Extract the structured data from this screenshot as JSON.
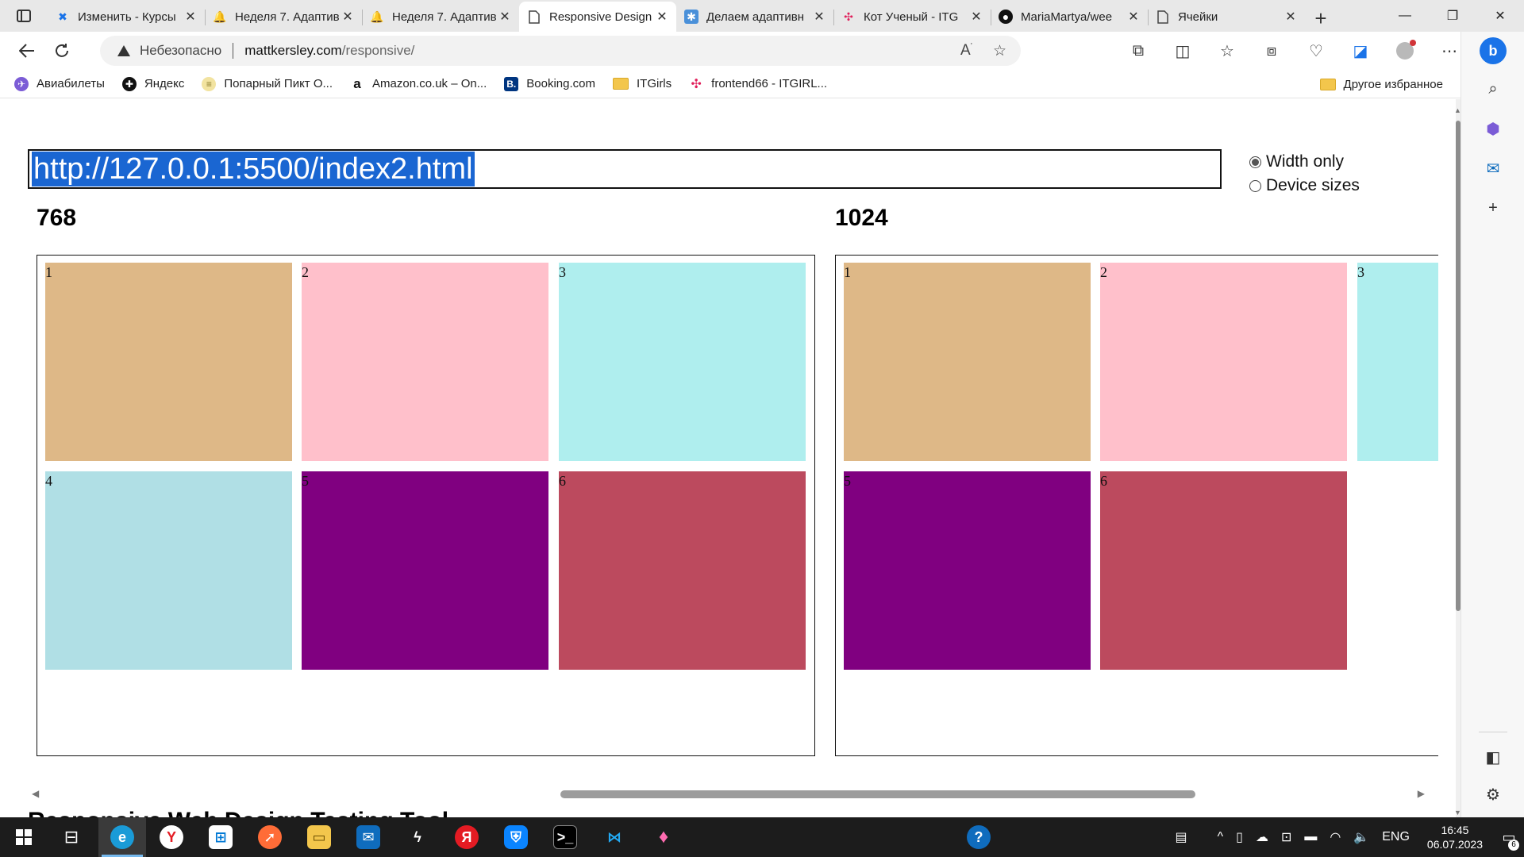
{
  "tabs": [
    {
      "title": "Изменить - Курсы",
      "icon": "tilda-icon",
      "color": "#1a73e8",
      "active": false
    },
    {
      "title": "Неделя 7. Адаптив",
      "icon": "bell-icon",
      "color": "#f4b400",
      "active": false
    },
    {
      "title": "Неделя 7. Адаптив",
      "icon": "bell-icon",
      "color": "#f4b400",
      "active": false
    },
    {
      "title": "Responsive Design",
      "icon": "page-icon",
      "color": "#444444",
      "active": true
    },
    {
      "title": "Делаем адаптивн",
      "icon": "snowflake-icon",
      "color": "#4a90d9",
      "active": false
    },
    {
      "title": "Кот Ученый - ITG",
      "icon": "slack-icon",
      "color": "#e01e5a",
      "active": false
    },
    {
      "title": "MariaMartya/wee",
      "icon": "github-icon",
      "color": "#111111",
      "active": false
    },
    {
      "title": "Ячейки",
      "icon": "page-icon",
      "color": "#444444",
      "active": false
    }
  ],
  "address": {
    "insecure_label": "Небезопасно",
    "host": "mattkersley.com",
    "path": "/responsive/"
  },
  "bookmarks": [
    {
      "label": "Авиабилеты",
      "icon": "aviasales-icon",
      "color": "#7b5cd6"
    },
    {
      "label": "Яндекс",
      "icon": "yandex-icon",
      "color": "#111111"
    },
    {
      "label": "Попарный Пикт О...",
      "icon": "pict-icon",
      "color": "#f2e3a0"
    },
    {
      "label": "Amazon.co.uk – On...",
      "icon": "amazon-icon",
      "color": "#111111"
    },
    {
      "label": "Booking.com",
      "icon": "booking-icon",
      "color": "#003580"
    },
    {
      "label": "ITGirls",
      "icon": "folder-icon",
      "color": "#f3c64c"
    },
    {
      "label": "frontend66 - ITGIRL...",
      "icon": "slack-icon",
      "color": "#e01e5a"
    }
  ],
  "bookmarks_other": "Другое избранное",
  "responsive": {
    "url_value": "http://127.0.0.1:5500/index2.html",
    "radio_width_only": "Width only",
    "radio_device_sizes": "Device sizes",
    "selected_mode": "width-only",
    "frames": [
      {
        "label": "768",
        "cells": [
          {
            "n": "1",
            "color": "#deb887"
          },
          {
            "n": "2",
            "color": "#ffc0cb"
          },
          {
            "n": "3",
            "color": "#afeeee"
          },
          {
            "n": "4",
            "color": "#b0dfe5"
          },
          {
            "n": "5",
            "color": "#800080"
          },
          {
            "n": "6",
            "color": "#bc4a5e"
          }
        ]
      },
      {
        "label": "1024",
        "cells": [
          {
            "n": "1",
            "color": "#deb887"
          },
          {
            "n": "2",
            "color": "#ffc0cb"
          },
          {
            "n": "3",
            "color": "#afeeee"
          },
          {
            "n": "5",
            "color": "#800080"
          },
          {
            "n": "6",
            "color": "#bc4a5e"
          }
        ]
      }
    ],
    "page_heading_partial": "Responsive Web Design Testing Tool"
  },
  "taskbar": {
    "apps": [
      {
        "name": "start-button-icon"
      },
      {
        "name": "task-view-icon"
      },
      {
        "name": "edge-icon",
        "active": true
      },
      {
        "name": "yandex-browser-icon"
      },
      {
        "name": "microsoft-store-icon"
      },
      {
        "name": "postman-icon"
      },
      {
        "name": "file-explorer-icon"
      },
      {
        "name": "mail-icon"
      },
      {
        "name": "sublime-icon"
      },
      {
        "name": "yandex-icon"
      },
      {
        "name": "vpn-shield-icon"
      },
      {
        "name": "terminal-icon"
      },
      {
        "name": "vscode-icon"
      },
      {
        "name": "paint-drop-icon"
      }
    ],
    "lang": "ENG",
    "time": "16:45",
    "date": "06.07.2023",
    "notifications_count": "6"
  },
  "colors": {
    "accent": "#1a66d2",
    "taskbar": "#1c1c1c"
  }
}
